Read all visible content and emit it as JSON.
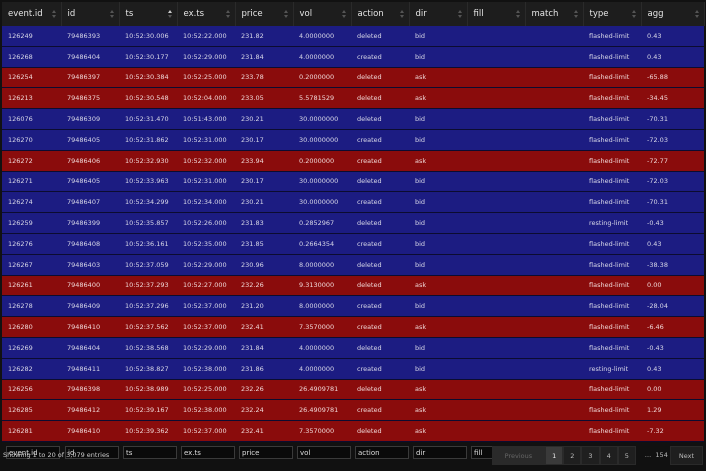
{
  "columns": [
    "event.id",
    "id",
    "ts",
    "ex.ts",
    "price",
    "vol",
    "action",
    "dir",
    "fill",
    "match",
    "type",
    "agg"
  ],
  "sorted_column": "ts",
  "rows": [
    {
      "dir_class": "bid",
      "cells": [
        "126249",
        "79486393",
        "10:52:30.006",
        "10:52:22.000",
        "231.82",
        "4.0000000",
        "deleted",
        "bid",
        "",
        "",
        "flashed-limit",
        "0.43"
      ]
    },
    {
      "dir_class": "bid",
      "cells": [
        "126268",
        "79486404",
        "10:52:30.177",
        "10:52:29.000",
        "231.84",
        "4.0000000",
        "created",
        "bid",
        "",
        "",
        "flashed-limit",
        "0.43"
      ]
    },
    {
      "dir_class": "ask",
      "cells": [
        "126254",
        "79486397",
        "10:52:30.384",
        "10:52:25.000",
        "233.78",
        "0.2000000",
        "deleted",
        "ask",
        "",
        "",
        "flashed-limit",
        "-65.88"
      ]
    },
    {
      "dir_class": "ask",
      "cells": [
        "126213",
        "79486375",
        "10:52:30.548",
        "10:52:04.000",
        "233.05",
        "5.5781529",
        "deleted",
        "ask",
        "",
        "",
        "flashed-limit",
        "-34.45"
      ]
    },
    {
      "dir_class": "bid",
      "cells": [
        "126076",
        "79486309",
        "10:52:31.470",
        "10:51:43.000",
        "230.21",
        "30.0000000",
        "deleted",
        "bid",
        "",
        "",
        "flashed-limit",
        "-70.31"
      ]
    },
    {
      "dir_class": "bid",
      "cells": [
        "126270",
        "79486405",
        "10:52:31.862",
        "10:52:31.000",
        "230.17",
        "30.0000000",
        "created",
        "bid",
        "",
        "",
        "flashed-limit",
        "-72.03"
      ]
    },
    {
      "dir_class": "ask",
      "cells": [
        "126272",
        "79486406",
        "10:52:32.930",
        "10:52:32.000",
        "233.94",
        "0.2000000",
        "created",
        "ask",
        "",
        "",
        "flashed-limit",
        "-72.77"
      ]
    },
    {
      "dir_class": "bid",
      "cells": [
        "126271",
        "79486405",
        "10:52:33.963",
        "10:52:31.000",
        "230.17",
        "30.0000000",
        "deleted",
        "bid",
        "",
        "",
        "flashed-limit",
        "-72.03"
      ]
    },
    {
      "dir_class": "bid",
      "cells": [
        "126274",
        "79486407",
        "10:52:34.299",
        "10:52:34.000",
        "230.21",
        "30.0000000",
        "created",
        "bid",
        "",
        "",
        "flashed-limit",
        "-70.31"
      ]
    },
    {
      "dir_class": "bid",
      "cells": [
        "126259",
        "79486399",
        "10:52:35.857",
        "10:52:26.000",
        "231.83",
        "0.2852967",
        "deleted",
        "bid",
        "",
        "",
        "resting-limit",
        "-0.43"
      ]
    },
    {
      "dir_class": "bid",
      "cells": [
        "126276",
        "79486408",
        "10:52:36.161",
        "10:52:35.000",
        "231.85",
        "0.2664354",
        "created",
        "bid",
        "",
        "",
        "flashed-limit",
        "0.43"
      ]
    },
    {
      "dir_class": "bid",
      "cells": [
        "126267",
        "79486403",
        "10:52:37.059",
        "10:52:29.000",
        "230.96",
        "8.0000000",
        "deleted",
        "bid",
        "",
        "",
        "flashed-limit",
        "-38.38"
      ]
    },
    {
      "dir_class": "ask",
      "cells": [
        "126261",
        "79486400",
        "10:52:37.293",
        "10:52:27.000",
        "232.26",
        "9.3130000",
        "deleted",
        "ask",
        "",
        "",
        "flashed-limit",
        "0.00"
      ]
    },
    {
      "dir_class": "bid",
      "cells": [
        "126278",
        "79486409",
        "10:52:37.296",
        "10:52:37.000",
        "231.20",
        "8.0000000",
        "created",
        "bid",
        "",
        "",
        "flashed-limit",
        "-28.04"
      ]
    },
    {
      "dir_class": "ask",
      "cells": [
        "126280",
        "79486410",
        "10:52:37.562",
        "10:52:37.000",
        "232.41",
        "7.3570000",
        "created",
        "ask",
        "",
        "",
        "flashed-limit",
        "-6.46"
      ]
    },
    {
      "dir_class": "bid",
      "cells": [
        "126269",
        "79486404",
        "10:52:38.568",
        "10:52:29.000",
        "231.84",
        "4.0000000",
        "deleted",
        "bid",
        "",
        "",
        "flashed-limit",
        "-0.43"
      ]
    },
    {
      "dir_class": "bid",
      "cells": [
        "126282",
        "79486411",
        "10:52:38.827",
        "10:52:38.000",
        "231.86",
        "4.0000000",
        "created",
        "bid",
        "",
        "",
        "resting-limit",
        "0.43"
      ]
    },
    {
      "dir_class": "ask",
      "cells": [
        "126256",
        "79486398",
        "10:52:38.989",
        "10:52:25.000",
        "232.26",
        "26.4909781",
        "deleted",
        "ask",
        "",
        "",
        "flashed-limit",
        "0.00"
      ]
    },
    {
      "dir_class": "ask",
      "cells": [
        "126285",
        "79486412",
        "10:52:39.167",
        "10:52:38.000",
        "232.24",
        "26.4909781",
        "created",
        "ask",
        "",
        "",
        "flashed-limit",
        "1.29"
      ]
    },
    {
      "dir_class": "ask",
      "cells": [
        "126281",
        "79486410",
        "10:52:39.362",
        "10:52:37.000",
        "232.41",
        "7.3570000",
        "deleted",
        "ask",
        "",
        "",
        "flashed-limit",
        "-7.32"
      ]
    }
  ],
  "filter_placeholders": [
    "event.id",
    "id",
    "ts",
    "ex.ts",
    "price",
    "vol",
    "action",
    "dir",
    "fill",
    "match",
    "type",
    "agg"
  ],
  "info_text": "Showing 1 to 20 of 3,079 entries",
  "pagination": {
    "previous": "Previous",
    "pages": [
      "1",
      "2",
      "3",
      "4",
      "5"
    ],
    "current": "1",
    "ellipsis": "…",
    "last": "154",
    "next": "Next"
  },
  "colors": {
    "bid_row": "#1c1c82",
    "ask_row": "#8a0c0c",
    "background": "#111111"
  }
}
